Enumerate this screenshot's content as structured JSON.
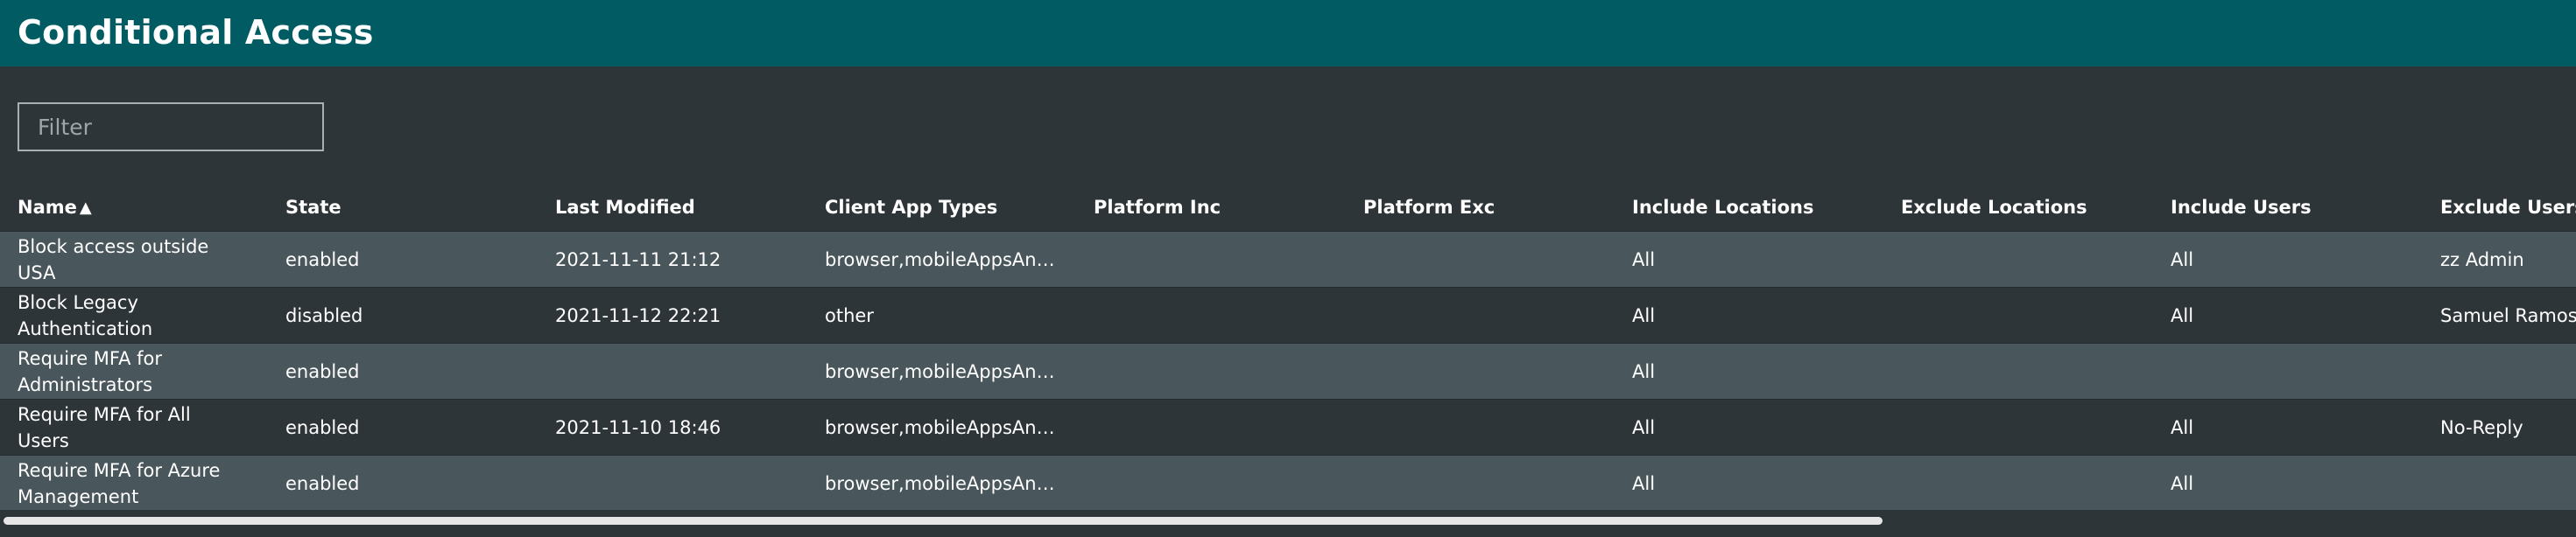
{
  "header": {
    "title": "Conditional Access"
  },
  "filter": {
    "placeholder": "Filter",
    "value": ""
  },
  "table": {
    "columns": [
      {
        "label": "Name",
        "sorted": "ascending"
      },
      {
        "label": "State"
      },
      {
        "label": "Last Modified"
      },
      {
        "label": "Client App Types"
      },
      {
        "label": "Platform Inc"
      },
      {
        "label": "Platform Exc"
      },
      {
        "label": "Include Locations"
      },
      {
        "label": "Exclude Locations"
      },
      {
        "label": "Include Users"
      },
      {
        "label": "Exclude Users"
      }
    ],
    "sort_icon": "▲",
    "rows": [
      [
        "Block access outside USA",
        "enabled",
        "2021-11-11 21:12",
        "browser,mobileAppsAndDesktopClients",
        "",
        "",
        "All",
        "",
        "All",
        "zz Admin"
      ],
      [
        "Block Legacy Authentication",
        "disabled",
        "2021-11-12 22:21",
        "other",
        "",
        "",
        "All",
        "",
        "All",
        "Samuel Ramos"
      ],
      [
        "Require MFA for Administrators",
        "enabled",
        "",
        "browser,mobileAppsAndDesktopClients",
        "",
        "",
        "All",
        "",
        "",
        ""
      ],
      [
        "Require MFA for All Users",
        "enabled",
        "2021-11-10 18:46",
        "browser,mobileAppsAndDesktopClients",
        "",
        "",
        "All",
        "",
        "All",
        "No-Reply"
      ],
      [
        "Require MFA for Azure Management",
        "enabled",
        "",
        "browser,mobileAppsAndDesktopClients",
        "",
        "",
        "All",
        "",
        "All",
        ""
      ]
    ]
  },
  "colors": {
    "header_bg": "#015b63",
    "page_bg": "#2e3538",
    "row_alt_bg": "#49565b",
    "text": "#ffffff"
  }
}
